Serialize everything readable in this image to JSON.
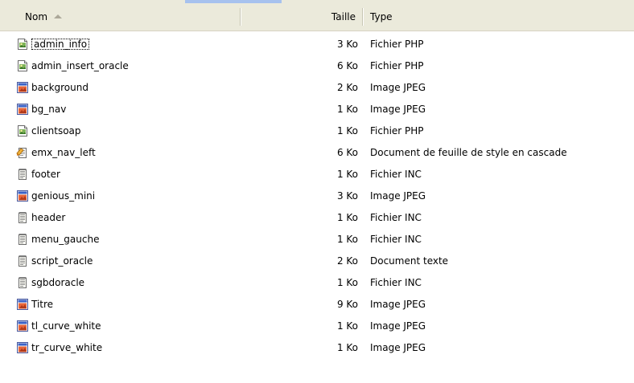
{
  "columns": {
    "name": "Nom",
    "size": "Taille",
    "type": "Type"
  },
  "colors": {
    "header_bg": "#ebeadb",
    "header_accent": "#a7c2ee"
  },
  "files": [
    {
      "name": "admin_info",
      "size": "3 Ko",
      "type": "Fichier PHP",
      "icon": "php-file-icon",
      "focused": true
    },
    {
      "name": "admin_insert_oracle",
      "size": "6 Ko",
      "type": "Fichier PHP",
      "icon": "php-file-icon"
    },
    {
      "name": "background",
      "size": "2 Ko",
      "type": "Image JPEG",
      "icon": "jpeg-image-icon"
    },
    {
      "name": "bg_nav",
      "size": "1 Ko",
      "type": "Image JPEG",
      "icon": "jpeg-image-icon"
    },
    {
      "name": "clientsoap",
      "size": "1 Ko",
      "type": "Fichier PHP",
      "icon": "php-file-icon"
    },
    {
      "name": "emx_nav_left",
      "size": "6 Ko",
      "type": "Document de feuille de style en cascade",
      "icon": "css-file-icon"
    },
    {
      "name": "footer",
      "size": "1 Ko",
      "type": "Fichier INC",
      "icon": "text-file-icon"
    },
    {
      "name": "genious_mini",
      "size": "3 Ko",
      "type": "Image JPEG",
      "icon": "jpeg-image-icon"
    },
    {
      "name": "header",
      "size": "1 Ko",
      "type": "Fichier INC",
      "icon": "text-file-icon"
    },
    {
      "name": "menu_gauche",
      "size": "1 Ko",
      "type": "Fichier INC",
      "icon": "text-file-icon"
    },
    {
      "name": "script_oracle",
      "size": "2 Ko",
      "type": "Document texte",
      "icon": "text-file-icon"
    },
    {
      "name": "sgbdoracle",
      "size": "1 Ko",
      "type": "Fichier INC",
      "icon": "text-file-icon"
    },
    {
      "name": "Titre",
      "size": "9 Ko",
      "type": "Image JPEG",
      "icon": "jpeg-image-icon"
    },
    {
      "name": "tl_curve_white",
      "size": "1 Ko",
      "type": "Image JPEG",
      "icon": "jpeg-image-icon"
    },
    {
      "name": "tr_curve_white",
      "size": "1 Ko",
      "type": "Image JPEG",
      "icon": "jpeg-image-icon"
    }
  ]
}
